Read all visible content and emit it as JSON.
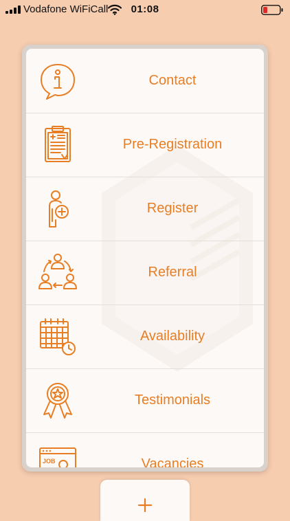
{
  "status_bar": {
    "carrier": "Vodafone WiFiCall",
    "time": "01:08",
    "icons": [
      "signal-icon",
      "wifi-icon",
      "battery-icon"
    ]
  },
  "theme": {
    "background": "#f7cdb0",
    "accent": "#e87e24",
    "card": "#fdf9f6"
  },
  "menu": {
    "items": [
      {
        "label": "Contact",
        "icon": "info-chat-icon"
      },
      {
        "label": "Pre-Registration",
        "icon": "clipboard-icon"
      },
      {
        "label": "Register",
        "icon": "person-add-icon"
      },
      {
        "label": "Referral",
        "icon": "referral-people-icon"
      },
      {
        "label": "Availability",
        "icon": "calendar-clock-icon"
      },
      {
        "label": "Testimonials",
        "icon": "award-ribbon-icon"
      },
      {
        "label": "Vacancies",
        "icon": "job-browser-icon"
      }
    ]
  },
  "add_button": {
    "label": "+",
    "icon": "plus-icon"
  }
}
